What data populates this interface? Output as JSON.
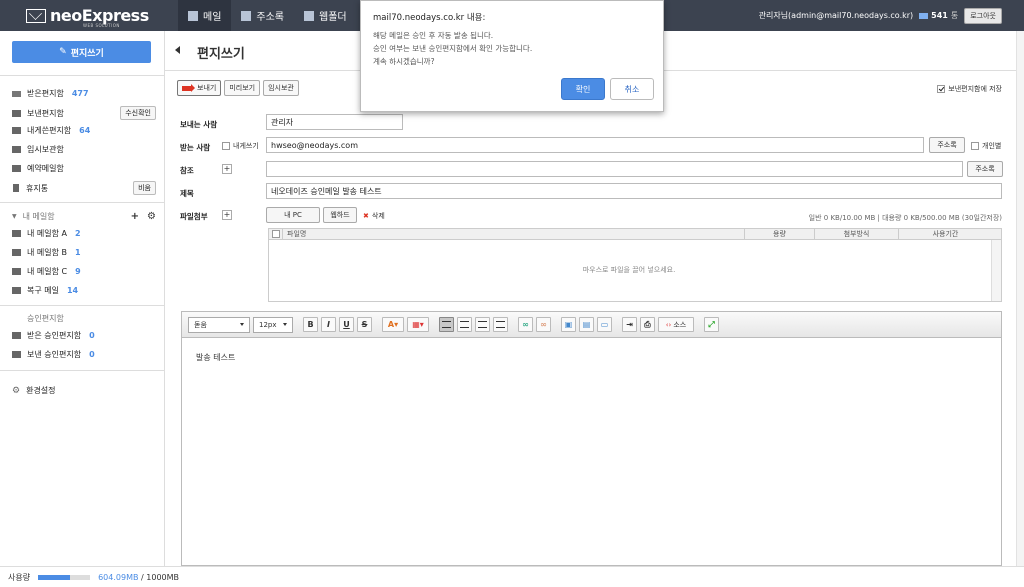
{
  "brand": {
    "name": "neoExpress",
    "sub": "WEB SOLUTION"
  },
  "topnav": [
    {
      "label": "메일",
      "icon": "mail-icon"
    },
    {
      "label": "주소록",
      "icon": "addressbook-icon"
    },
    {
      "label": "웹폴더",
      "icon": "webfolder-icon"
    }
  ],
  "user": {
    "label": "관리자님(admin@mail70.neodays.co.kr)",
    "mail_count": "541",
    "mail_count_suffix": "통",
    "logout": "로그아웃"
  },
  "sidebar": {
    "compose": "편지쓰기",
    "folders": [
      {
        "label": "받은편지함",
        "count": "477"
      },
      {
        "label": "보낸편지함",
        "button": "수신확인"
      },
      {
        "label": "내게쓴편지함",
        "count": "64"
      },
      {
        "label": "임시보관함"
      },
      {
        "label": "예약메일함"
      },
      {
        "label": "휴지통",
        "button": "비움"
      }
    ],
    "my_group": "내 메일함",
    "my_folders": [
      {
        "label": "내 메일함 A",
        "count": "2"
      },
      {
        "label": "내 메일함 B",
        "count": "1"
      },
      {
        "label": "내 메일함 C",
        "count": "9"
      },
      {
        "label": "복구 메일",
        "count": "14"
      }
    ],
    "approval_group": "승인편지함",
    "approval_folders": [
      {
        "label": "받은 승인편지함",
        "count": "0"
      },
      {
        "label": "보낸 승인편지함",
        "count": "0"
      }
    ],
    "settings": "환경설정"
  },
  "storage": {
    "label": "사용량",
    "used": "604.09MB",
    "total": "/ 1000MB",
    "fraction": 0.604
  },
  "main": {
    "title": "편지쓰기",
    "toolbar": {
      "send": "보내기",
      "preview": "미리보기",
      "draft": "임시보관"
    },
    "save_sent": "보낸편지함에 저장",
    "sender_label": "보내는 사람",
    "sender_value": "관리자",
    "to_label": "받는 사람",
    "to_self": "내게쓰기",
    "to_value": "hwseo@neodays.com",
    "addressbook": "주소록",
    "individual": "개인별",
    "cc_label": "참조",
    "cc_value": "",
    "subject_label": "제목",
    "subject_value": "네오데이즈 승인메일 발송 테스트",
    "attach_label": "파일첨부",
    "my_pc": "내 PC",
    "webhard": "웹하드",
    "delete": "삭제",
    "attach_info": "일반 0 KB/10.00 MB  |  대용량 0 KB/500.00 MB (30일간저장)",
    "file_cols": [
      "파일명",
      "용량",
      "첨부방식",
      "사용기간"
    ],
    "drop_hint": "마우스로 파일을 끌어 넣으세요.",
    "font_select": "돋움",
    "size_select": "12px",
    "source": "소스",
    "body": "발송 테스트"
  },
  "dialog": {
    "title": "mail70.neodays.co.kr 내용:",
    "line1": "해당 메일은 승인 후 자동 발송 됩니다.",
    "line2": "승인 여부는 보낸 승인편지함에서 확인 가능합니다.",
    "line3": "계속 하시겠습니까?",
    "ok": "확인",
    "cancel": "취소"
  }
}
